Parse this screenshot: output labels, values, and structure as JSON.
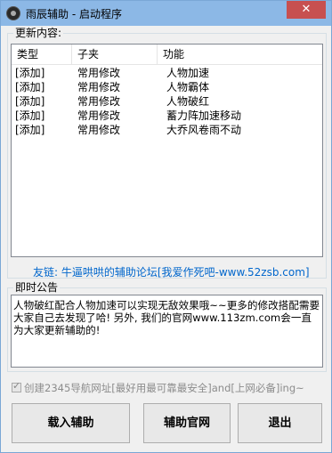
{
  "window": {
    "title": "雨辰辅助 - 启动程序",
    "close_glyph": "✕"
  },
  "updates": {
    "legend": "更新内容:",
    "columns": [
      "类型",
      "子夹",
      "功能"
    ],
    "rows": [
      [
        "[添加]",
        "常用修改",
        "人物加速"
      ],
      [
        "[添加]",
        "常用修改",
        "人物霸体"
      ],
      [
        "[添加]",
        "常用修改",
        "人物破红"
      ],
      [
        "[添加]",
        "常用修改",
        "蓄力阵加速移动"
      ],
      [
        "[添加]",
        "常用修改",
        "大乔风卷雨不动"
      ]
    ]
  },
  "friend_link": "友链: 牛逼哄哄的辅助论坛[我爱作死吧-www.52zsb.com]",
  "announcement": {
    "legend": "即时公告",
    "text": "人物破红配合人物加速可以实现无敌效果哦~~更多的修改搭配需要大家自己去发现了哈! 另外, 我们的官网www.113zm.com会一直为大家更新辅助的!"
  },
  "checkbox": {
    "label": "创建2345导航网址[最好用最可靠最安全]and[上网必备]ing~",
    "checked": true
  },
  "buttons": {
    "load": "载入辅助",
    "site": "辅助官网",
    "exit": "退出"
  }
}
